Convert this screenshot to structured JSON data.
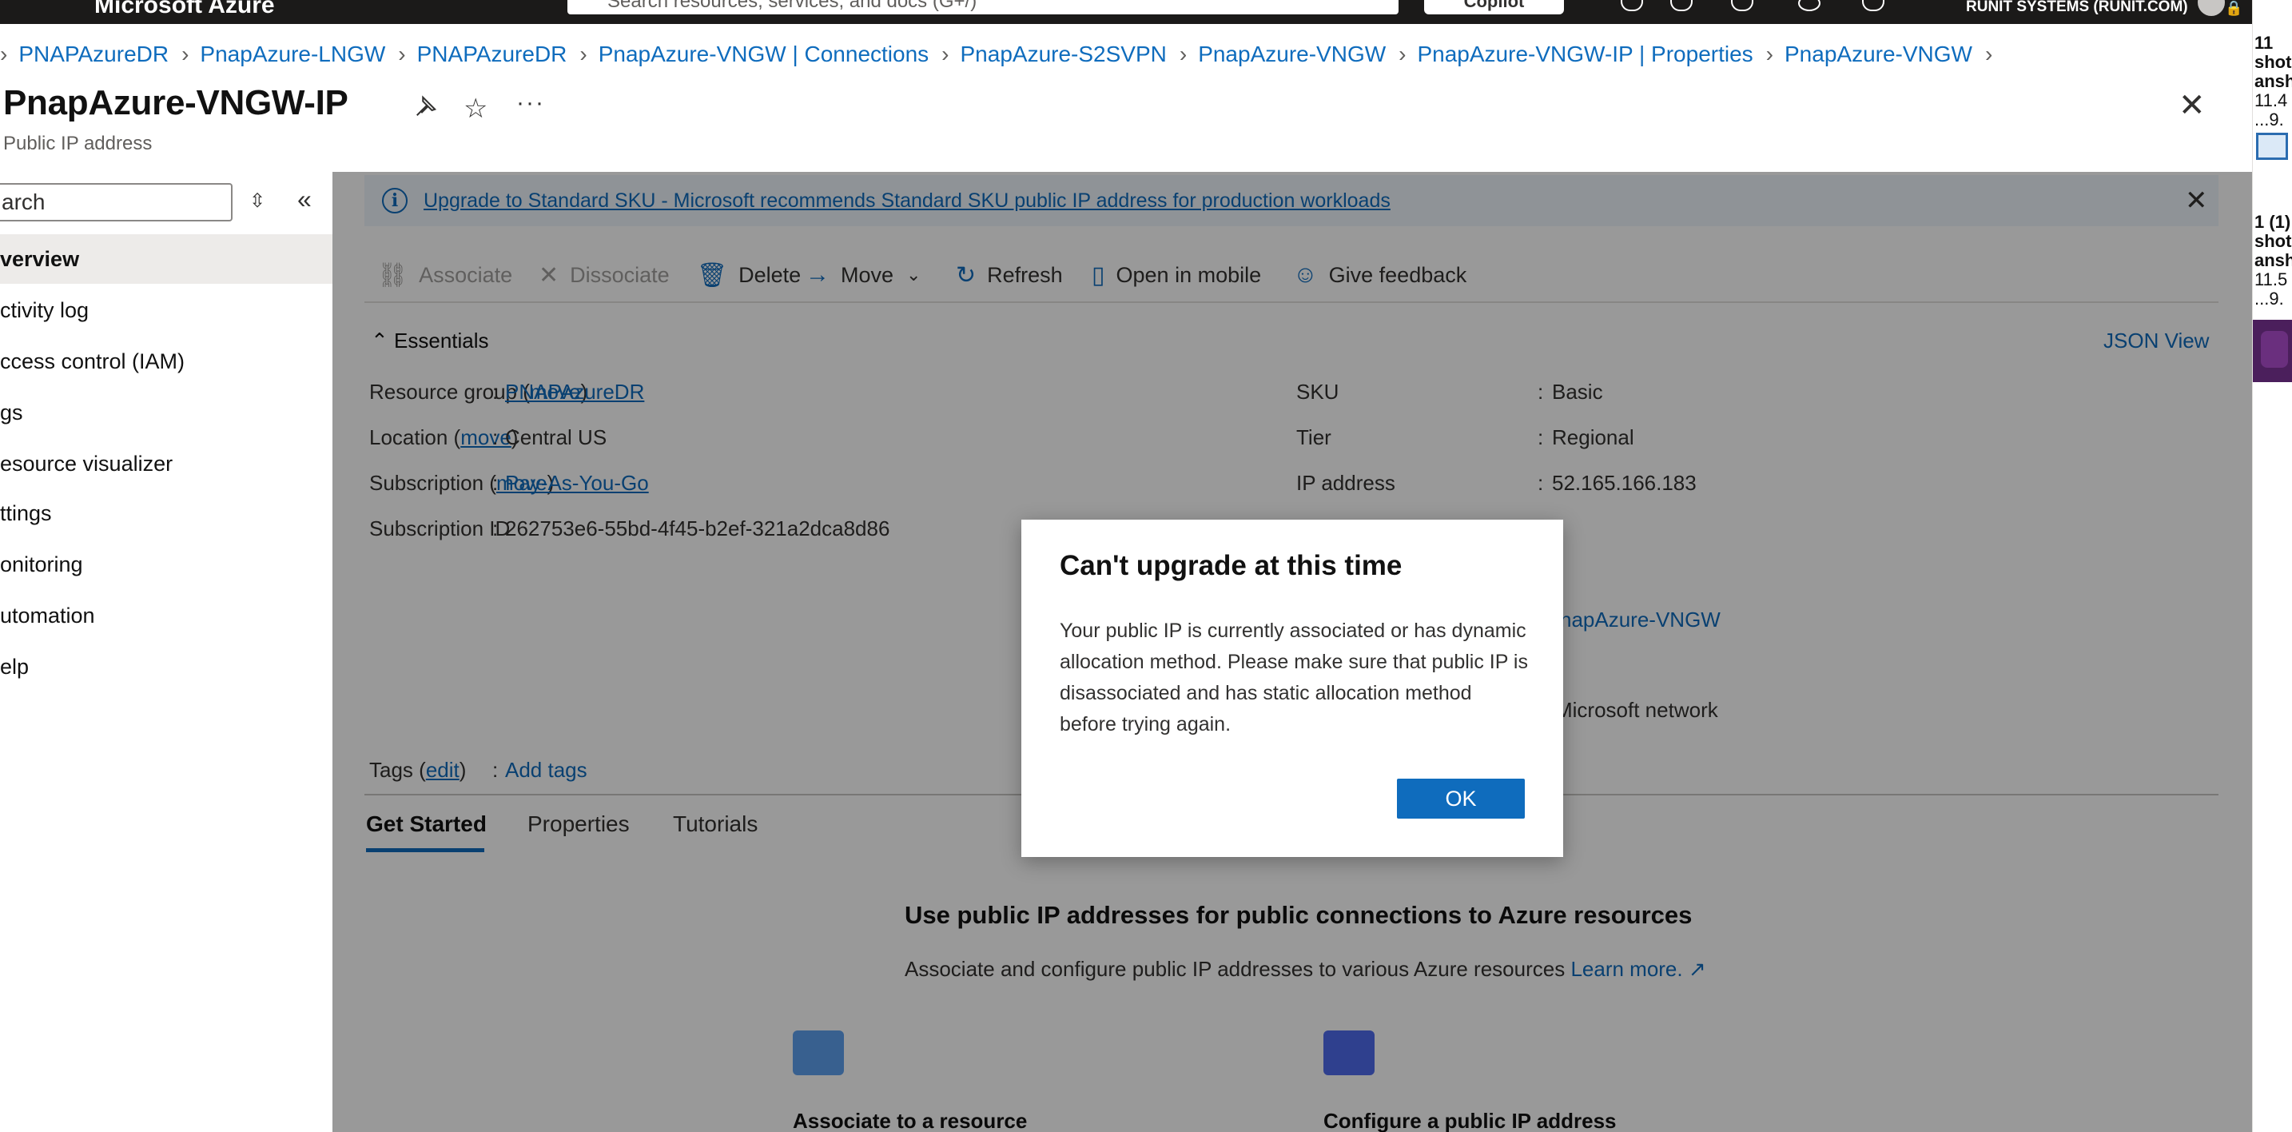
{
  "topbar": {
    "brand": "Microsoft Azure",
    "search_placeholder": "Search resources, services, and docs (G+/)",
    "copilot_label": "Copilot",
    "account": "RUNIT SYSTEMS (RUNIT.COM)"
  },
  "breadcrumb": [
    "PNAPAzureDR",
    "PnapAzure-LNGW",
    "PNAPAzureDR",
    "PnapAzure-VNGW | Connections",
    "PnapAzure-S2SVPN",
    "PnapAzure-VNGW",
    "PnapAzure-VNGW-IP | Properties",
    "PnapAzure-VNGW"
  ],
  "header": {
    "title": "PnapAzure-VNGW-IP",
    "subtitle": "Public IP address",
    "more": "···"
  },
  "leftnav": {
    "search_text": "arch",
    "items": [
      "verview",
      "ctivity log",
      "ccess control (IAM)",
      "gs",
      "esource visualizer",
      "ttings",
      "onitoring",
      "utomation",
      "elp"
    ]
  },
  "banner": {
    "text": "Upgrade to Standard SKU - Microsoft recommends Standard SKU public IP address for production workloads"
  },
  "commands": {
    "associate": "Associate",
    "dissociate": "Dissociate",
    "delete": "Delete",
    "move": "Move",
    "refresh": "Refresh",
    "open_mobile": "Open in mobile",
    "feedback": "Give feedback"
  },
  "essentials": {
    "header": "Essentials",
    "json_view": "JSON View",
    "move_link": "move",
    "edit_link": "edit",
    "resource_group_label": "Resource group",
    "resource_group_value": "PNAPAzureDR",
    "location_label": "Location",
    "location_value": "Central US",
    "subscription_label": "Subscription",
    "subscription_value": "Pay-As-You-Go",
    "subscription_id_label": "Subscription ID",
    "subscription_id_value": "262753e6-55bd-4f45-b2ef-321a2dca8d86",
    "tags_label": "Tags",
    "tags_value": "Add tags",
    "sku_label": "SKU",
    "sku_value": "Basic",
    "tier_label": "Tier",
    "tier_value": "Regional",
    "ip_label": "IP address",
    "ip_value": "52.165.166.183",
    "associated_value_partial": "napAzure-VNGW",
    "routing_value_partial": "Microsoft network",
    "colon": ":"
  },
  "tabs": [
    "Get Started",
    "Properties",
    "Tutorials"
  ],
  "get_started": {
    "title": "Use public IP addresses for public connections to Azure resources",
    "subtitle": "Associate and configure public IP addresses to various Azure resources",
    "learn_more": "Learn more.",
    "card1": "Associate to a resource",
    "card2": "Configure a public IP address"
  },
  "dialog": {
    "title": "Can't upgrade at this time",
    "body": "Your public IP is currently associated or has dynamic allocation method. Please make sure that public IP is disassociated and has static allocation method before trying again.",
    "ok": "OK"
  },
  "desktop_strip": {
    "line1": "11",
    "line2": "shot",
    "line3": "ansh",
    "line4": "11.4",
    "line5": "...9.",
    "line6": "1 (1)",
    "line7": "shot",
    "line8": "ansh",
    "line9": "11.5",
    "line10": "...9."
  },
  "colors": {
    "accent": "#0f6cbd",
    "topbar": "#1b1a19",
    "banner": "#eff6fc",
    "overlay": "rgba(0,0,0,0.4)"
  }
}
